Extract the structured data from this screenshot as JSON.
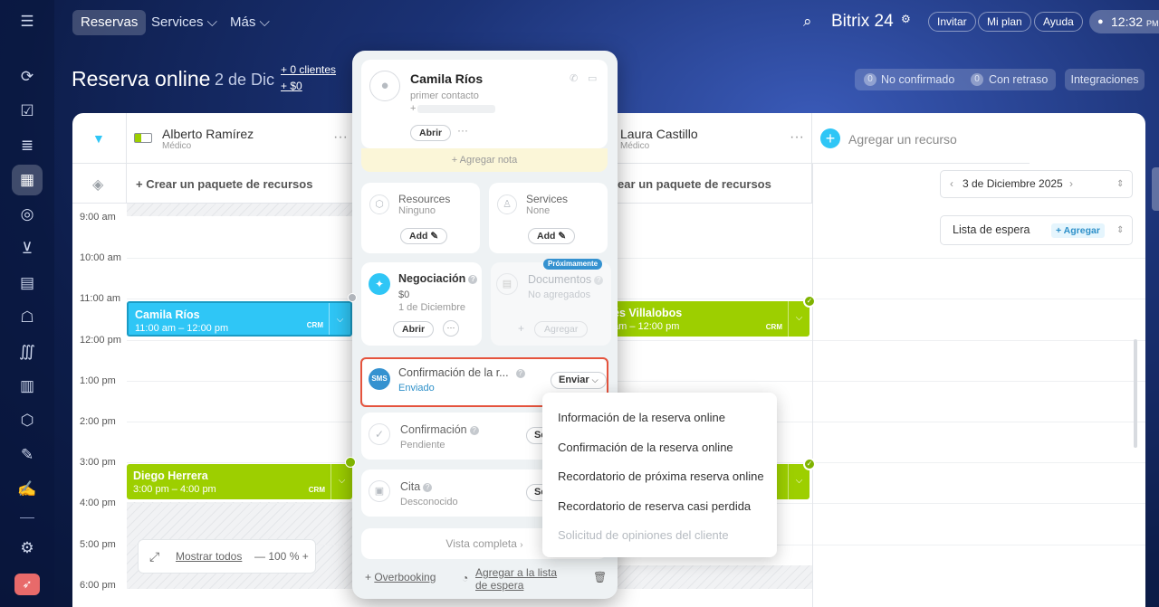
{
  "nav": {
    "tab_active": "Reservas",
    "tab_services": "Services ⌵",
    "tab_more": "Más ⌵",
    "logo": "Bitrix 24",
    "invite": "Invitar",
    "plan": "Mi plan",
    "help": "Ayuda",
    "clock": "12:32",
    "clock_suffix": "PM"
  },
  "page": {
    "title": "Reserva online",
    "date": "2 de Dic",
    "clients": "+ 0 clientes",
    "amount": "+ $0",
    "unconfirmed_count": "0",
    "unconfirmed": "No confirmado",
    "late_count": "0",
    "late": "Con retraso",
    "integrations": "Integraciones"
  },
  "resources": [
    {
      "name": "Alberto Ramírez",
      "role": "Médico"
    },
    {
      "name": "Laura Castillo",
      "role": "Médico"
    }
  ],
  "add_resource": "Agregar un recurso",
  "create_package": "+ Crear un paquete de recursos",
  "create_package_2": "rear un paquete de recursos",
  "date_picker": "3 de Diciembre 2025",
  "waitlist": {
    "label": "Lista de espera",
    "add": "+ Agregar"
  },
  "times": [
    "9:00 am",
    "10:00 am",
    "11:00 am",
    "12:00 pm",
    "1:00 pm",
    "2:00 pm",
    "3:00 pm",
    "4:00 pm",
    "5:00 pm",
    "6:00 pm"
  ],
  "events": {
    "e1_name": "Camila Ríos",
    "e1_time": "11:00 am – 12:00 pm",
    "e2_name": "Diego Herrera",
    "e2_time": "3:00 pm – 4:00 pm",
    "e3_name": "és Villalobos",
    "e3_time": "am – 12:00 pm",
    "crm": "CRM"
  },
  "zoom": {
    "show_all": "Mostrar todos",
    "level": "— 100 % +"
  },
  "panel": {
    "client_name": "Camila Ríos",
    "client_sub": "primer contacto",
    "client_phone": "+",
    "open": "Abrir",
    "add_note": "+ Agregar nota",
    "resources_title": "Resources",
    "resources_val": "Ninguno",
    "services_title": "Services",
    "services_val": "None",
    "add": "Add",
    "deal_title": "Negociación",
    "deal_amount": "$0",
    "deal_date": "1 de Diciembre",
    "docs_badge": "Próximamente",
    "docs_title": "Documentos",
    "docs_val": "No agregados",
    "docs_add": "Agregar",
    "confirm_title": "Confirmación de la r...",
    "confirm_status": "Enviado",
    "send": "Enviar",
    "confirm2_title": "Confirmación",
    "confirm2_status": "Pendiente",
    "cut1": "Se",
    "cita_title": "Cita",
    "cita_status": "Desconocido",
    "cut2": "Se",
    "full_view": "Vista completa",
    "overbooking": "Overbooking",
    "add_waitlist_1": "Agregar a la lista",
    "add_waitlist_2": "de espera"
  },
  "dropdown": [
    "Información de la reserva online",
    "Confirmación de la reserva online",
    "Recordatorio de próxima reserva online",
    "Recordatorio de reserva casi perdida",
    "Solicitud de opiniones del cliente"
  ]
}
